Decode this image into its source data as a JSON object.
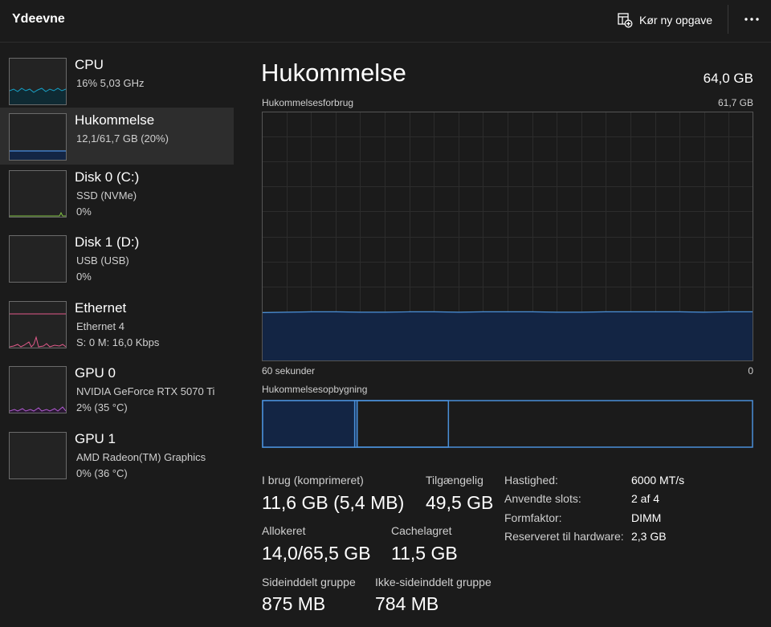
{
  "header": {
    "title": "Ydeevne",
    "run_task_label": "Kør ny opgave",
    "more_icon": "more-horizontal-icon"
  },
  "sidebar": {
    "items": [
      {
        "name": "CPU",
        "line1": "16%  5,03 GHz",
        "line2": "",
        "graph_color": "#17a2c8"
      },
      {
        "name": "Hukommelse",
        "line1": "12,1/61,7 GB (20%)",
        "line2": "",
        "graph_color": "#4a8fe0"
      },
      {
        "name": "Disk 0 (C:)",
        "line1": "SSD (NVMe)",
        "line2": "0%",
        "graph_color": "#7fc241"
      },
      {
        "name": "Disk 1 (D:)",
        "line1": "USB (USB)",
        "line2": "0%",
        "graph_color": "#7fc241"
      },
      {
        "name": "Ethernet",
        "line1": "Ethernet 4",
        "line2": "S: 0  M: 16,0 Kbps",
        "graph_color": "#e05a8a"
      },
      {
        "name": "GPU 0",
        "line1": "NVIDIA GeForce RTX 5070 Ti",
        "line2": "2%  (35 °C)",
        "graph_color": "#b05ad0"
      },
      {
        "name": "GPU 1",
        "line1": "AMD Radeon(TM) Graphics",
        "line2": "0%  (36 °C)",
        "graph_color": "#b05ad0"
      }
    ],
    "selected_index": 1
  },
  "main": {
    "title": "Hukommelse",
    "total": "64,0 GB",
    "usage_label": "Hukommelsesforbrug",
    "usage_max": "61,7 GB",
    "axis_left": "60 sekunder",
    "axis_right": "0",
    "composition_label": "Hukommelsesopbygning",
    "stats": {
      "in_use_label": "I brug (komprimeret)",
      "in_use_value": "11,6 GB (5,4 MB)",
      "available_label": "Tilgængelig",
      "available_value": "49,5 GB",
      "committed_label": "Allokeret",
      "committed_value": "14,0/65,5 GB",
      "cached_label": "Cachelagret",
      "cached_value": "11,5 GB",
      "paged_label": "Sideinddelt gruppe",
      "paged_value": "875 MB",
      "nonpaged_label": "Ikke-sideinddelt gruppe",
      "nonpaged_value": "784 MB"
    },
    "details": [
      {
        "label": "Hastighed:",
        "value": "6000 MT/s"
      },
      {
        "label": "Anvendte slots:",
        "value": "2 af 4"
      },
      {
        "label": "Formfaktor:",
        "value": "DIMM"
      },
      {
        "label": "Reserveret til hardware:",
        "value": "2,3 GB"
      }
    ]
  },
  "chart_data": {
    "type": "area",
    "title": "Hukommelsesforbrug",
    "xlabel": "",
    "ylabel": "",
    "x_range": [
      "60 sekunder",
      "0"
    ],
    "ylim": [
      0,
      61.7
    ],
    "unit": "GB",
    "series": [
      {
        "values": [
          11.9,
          12.0,
          12.1,
          12.1,
          12.0,
          12.0,
          12.1,
          12.1,
          12.0,
          12.1,
          12.1,
          12.1,
          12.0,
          12.0,
          12.1,
          12.1,
          12.1,
          12.1,
          12.0,
          12.1,
          12.1
        ]
      }
    ],
    "composition": {
      "in_use_gb": 11.6,
      "modified_gb": 0.3,
      "standby_gb": 11.5,
      "free_gb": 38.3
    },
    "colors": {
      "line": "#4a90d9",
      "fill": "#132544",
      "grid": "#2c2c2c",
      "border": "#555555"
    }
  }
}
